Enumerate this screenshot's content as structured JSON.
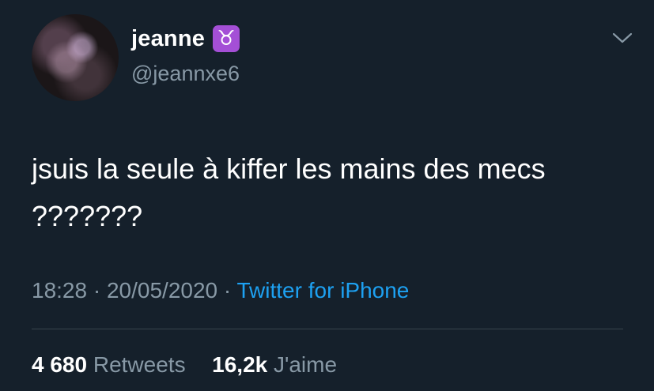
{
  "user": {
    "display_name": "jeanne",
    "badge_emoji": "♉",
    "handle": "@jeannxe6"
  },
  "tweet": {
    "text": "jsuis la seule à kiffer les mains des mecs ???????",
    "time": "18:28",
    "date": "20/05/2020",
    "separator": "·",
    "source": "Twitter for iPhone"
  },
  "stats": {
    "retweets_count": "4 680",
    "retweets_label": "Retweets",
    "likes_count": "16,2k",
    "likes_label": "J'aime"
  },
  "icons": {
    "more": "chevron-down-icon",
    "badge": "taurus-icon"
  },
  "colors": {
    "background": "#15202b",
    "secondary_text": "#8899a6",
    "link": "#1da1f2",
    "badge": "#a44fd6"
  }
}
